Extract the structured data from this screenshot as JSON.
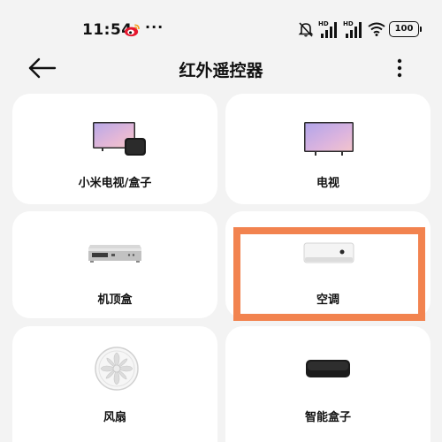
{
  "status_bar": {
    "time": "11:54",
    "more": "···",
    "battery": "100",
    "icons": [
      "weibo-icon",
      "bell-muted-icon",
      "signal-hd-icon",
      "signal-hd-icon",
      "wifi-icon",
      "battery-icon"
    ]
  },
  "header": {
    "title": "红外遥控器",
    "back_icon": "arrow-left-icon",
    "menu_icon": "more-vertical-icon"
  },
  "devices": [
    {
      "label": "小米电视/盒子",
      "icon": "tv-with-box-image"
    },
    {
      "label": "电视",
      "icon": "tv-image"
    },
    {
      "label": "机顶盒",
      "icon": "set-top-box-image"
    },
    {
      "label": "空调",
      "icon": "air-conditioner-image",
      "highlighted": true
    },
    {
      "label": "风扇",
      "icon": "fan-image"
    },
    {
      "label": "智能盒子",
      "icon": "smart-box-image"
    }
  ],
  "colors": {
    "background": "#f3f3f3",
    "card": "#ffffff",
    "highlight": "#f2834f"
  }
}
